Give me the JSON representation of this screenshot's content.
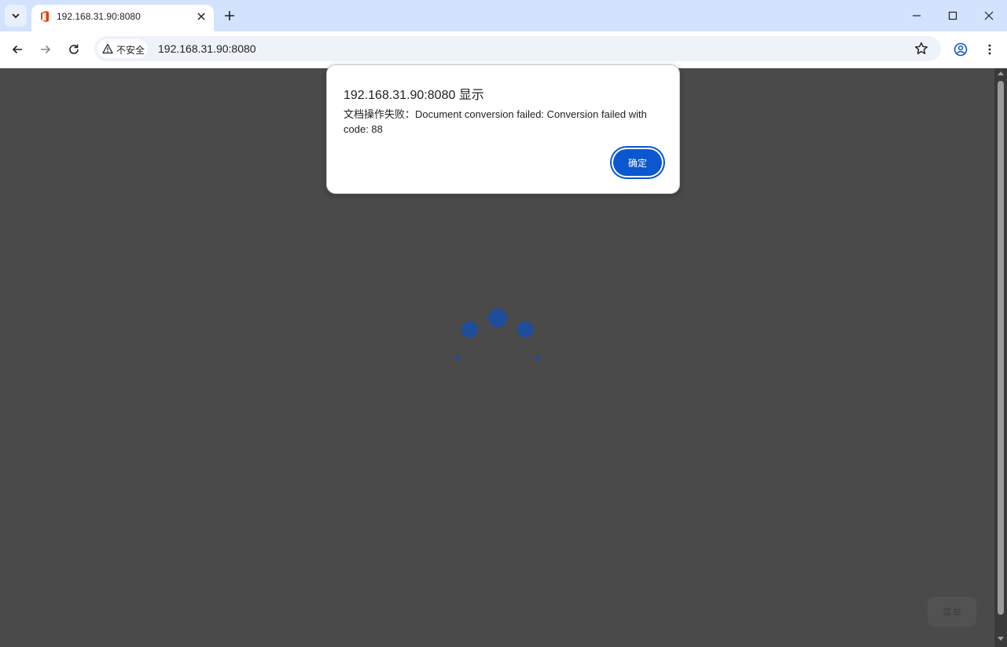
{
  "browser": {
    "tab": {
      "title": "192.168.31.90:8080"
    },
    "address_bar": {
      "security_label": "不安全",
      "url": "192.168.31.90:8080"
    }
  },
  "page": {
    "floating_button_label": "菜单"
  },
  "alert": {
    "title": "192.168.31.90:8080 显示",
    "message": "文档操作失败：Document conversion failed: Conversion failed with code: 88",
    "ok_label": "确定"
  },
  "colors": {
    "tabstrip_bg": "#d3e3fd",
    "page_overlay": "#4a4a4a",
    "accent": "#0b57d0",
    "spinner": "#1f4d99",
    "office_logo": "#eb3c00"
  }
}
